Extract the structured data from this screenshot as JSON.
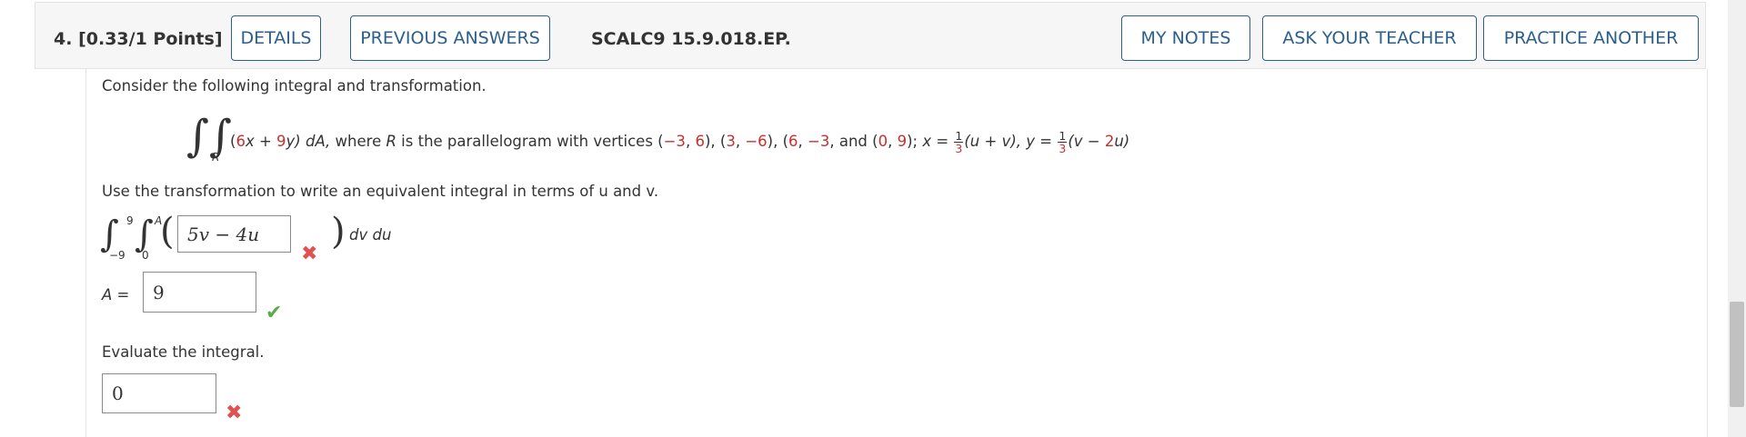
{
  "header": {
    "question_number": "4.",
    "points": "[0.33/1 Points]",
    "details_label": "DETAILS",
    "previous_answers_label": "PREVIOUS ANSWERS",
    "code": "SCALC9 15.9.018.EP.",
    "my_notes_label": "MY NOTES",
    "ask_teacher_label": "ASK YOUR TEACHER",
    "practice_another_label": "PRACTICE ANOTHER"
  },
  "question": {
    "intro": "Consider the following integral and transformation.",
    "region_subscript": "R",
    "integrand_open": "(",
    "coef_x": "6",
    "var_x": "x",
    "plus": " + ",
    "coef_y": "9",
    "var_y": "y",
    "integrand_close": ") dA, ",
    "where_text": "where ",
    "r_italic": "R",
    "parallelogram_text": " is the parallelogram with vertices (",
    "v1x": "−3",
    "v1y": "6",
    "v2x": "3",
    "v2y": "−6",
    "v3x": "6",
    "v3y": "−3",
    "v4x": "0",
    "v4y": "9",
    "sep": ", ",
    "and_text": ", and (",
    "close_semicolon": ");  ",
    "x_eq": "x = ",
    "frac1_num": "1",
    "frac1_den": "3",
    "x_expr": "(u + v), ",
    "y_eq": "y = ",
    "frac2_num": "1",
    "frac2_den": "3",
    "y_expr_open": "(v − ",
    "y_coef": "2",
    "y_expr_close": "u)"
  },
  "part1": {
    "instruction": "Use the transformation to write an equivalent integral in terms of u and v.",
    "outer_upper": "9",
    "outer_lower": "−9",
    "inner_upper": "A",
    "inner_lower": "0",
    "answer_value": "5v − 4u",
    "differentials": "dv du",
    "a_label": "A  =",
    "a_value": "9"
  },
  "part2": {
    "instruction": "Evaluate the integral.",
    "answer_value": "0"
  },
  "colors": {
    "accent": "#2b5f8c",
    "incorrect": "#e05252",
    "correct": "#5aab4a",
    "highlight": "#c8302e"
  }
}
